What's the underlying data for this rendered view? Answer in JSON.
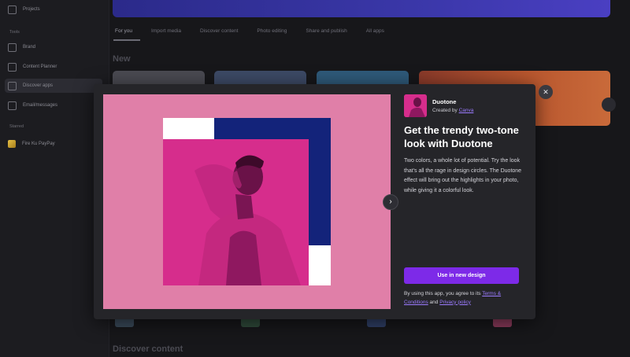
{
  "background": {
    "sidebar": {
      "projects": "Projects",
      "section_tools": "Tools",
      "items": [
        "Brand",
        "Content Planner",
        "Discover apps",
        "Email/messages"
      ],
      "section_starred": "Starred",
      "starred_item": "Fire Ku PayPay"
    },
    "tabs": [
      "For you",
      "Import media",
      "Discover content",
      "Photo editing",
      "Share and publish",
      "All apps"
    ],
    "section_new": "New",
    "section_discover": "Discover content"
  },
  "modal": {
    "app": {
      "name": "Duotone",
      "created_by": "Created by",
      "creator": "Canva"
    },
    "headline": "Get the trendy two-tone look with Duotone",
    "description": "Two colors, a whole lot of potential. Try the look that's all the rage in design circles. The Duotone effect will bring out the highlights in your photo, while giving it a colorful look.",
    "cta": "Use in new design",
    "legal": {
      "prefix": "By using this app, you agree to its",
      "terms": "Terms & Conditions",
      "and": "and",
      "privacy": "Privacy policy"
    },
    "icons": {
      "close": "close-icon",
      "next": "chevron-right-icon"
    }
  },
  "colors": {
    "accent": "#7d2ae8",
    "link": "#9b7bff",
    "duotone_pink": "#d62d8c",
    "duotone_navy": "#13237a",
    "preview_bg": "#e07fa8"
  }
}
